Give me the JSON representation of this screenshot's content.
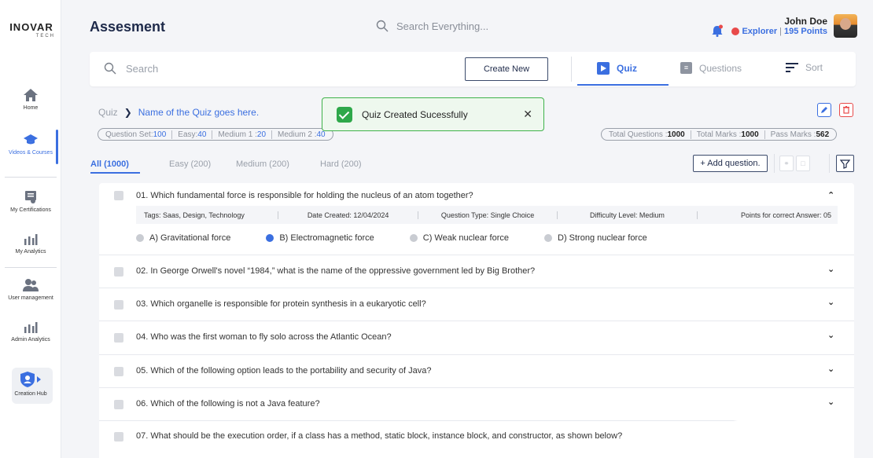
{
  "brand": {
    "line1": "INOVAR",
    "line2": "TECH"
  },
  "sidebar": {
    "items": [
      {
        "label": "Home",
        "icon": "home-icon"
      },
      {
        "label": "Videos & Courses",
        "icon": "graduation-cap-icon"
      },
      {
        "label": "My Certifications",
        "icon": "certificate-icon"
      },
      {
        "label": "My Analytics",
        "icon": "analytics-icon"
      },
      {
        "label": "User management",
        "icon": "users-icon"
      },
      {
        "label": "Admin Analytics",
        "icon": "analytics-icon"
      },
      {
        "label": "Creation Hub",
        "icon": "creation-hub-icon"
      }
    ]
  },
  "header": {
    "title": "Assesment",
    "search_placeholder": "Search Everything...",
    "user_name": "John Doe",
    "user_badge": "Explorer",
    "user_points": "195 Points",
    "user_sep": "|"
  },
  "toolbar": {
    "search_placeholder": "Search",
    "create_label": "Create New",
    "tabs": [
      {
        "label": "Quiz",
        "active": true
      },
      {
        "label": "Questions",
        "active": false
      },
      {
        "label": "Sort",
        "active": false
      }
    ]
  },
  "breadcrumb": {
    "root": "Quiz",
    "current": "Name of the Quiz goes here."
  },
  "toast": {
    "message": "Quiz Created Sucessfully"
  },
  "stats_left": [
    {
      "label": "Question Set:",
      "value": "100"
    },
    {
      "label": "Easy:",
      "value": "40"
    },
    {
      "label": "Medium 1 :",
      "value": "20"
    },
    {
      "label": "Medium 2 :",
      "value": "40"
    }
  ],
  "stats_right": [
    {
      "label": "Total Questions :",
      "value": "1000"
    },
    {
      "label": "Total Marks :",
      "value": "1000"
    },
    {
      "label": "Pass Marks :",
      "value": "562"
    }
  ],
  "filters": [
    {
      "label": "All (1000)",
      "active": true
    },
    {
      "label": "Easy (200)",
      "active": false
    },
    {
      "label": "Medium (200)",
      "active": false
    },
    {
      "label": "Hard (200)",
      "active": false
    }
  ],
  "add_question_label": "+ Add question.",
  "questions": [
    {
      "text": "01.  Which fundamental force is responsible for holding the nucleus of an atom together?",
      "expanded": true
    },
    {
      "text": "02.  In George Orwell's novel “1984,” what is the name of the oppressive government led by Big Brother?"
    },
    {
      "text": "03.  Which organelle is responsible for protein synthesis in a eukaryotic cell?"
    },
    {
      "text": "04.  Who was the first woman to fly solo across the Atlantic Ocean?"
    },
    {
      "text": "05.  Which of the following option leads to the portability and security of Java?"
    },
    {
      "text": "06.  Which of the following is not a Java feature?"
    },
    {
      "text": "07.  What should be the execution order, if a class has a method, static block, instance block, and constructor, as shown below?"
    }
  ],
  "q1_meta": {
    "tags": "Tags:  Saas,  Design,  Technology",
    "date": "Date Created:  12/04/2024",
    "type": "Question Type:  Single Choice",
    "difficulty": "Difficulty Level:  Medium",
    "points": "Points for correct Answer:  05"
  },
  "q1_options": [
    {
      "label": "A) Gravitational force",
      "selected": false
    },
    {
      "label": "B) Electromagnetic force",
      "selected": true
    },
    {
      "label": "C) Weak nuclear force",
      "selected": false
    },
    {
      "label": "D) Strong nuclear force",
      "selected": false
    }
  ],
  "colors": {
    "accent": "#3b6fe0",
    "success": "#2ea84a",
    "danger": "#e84a4a"
  }
}
